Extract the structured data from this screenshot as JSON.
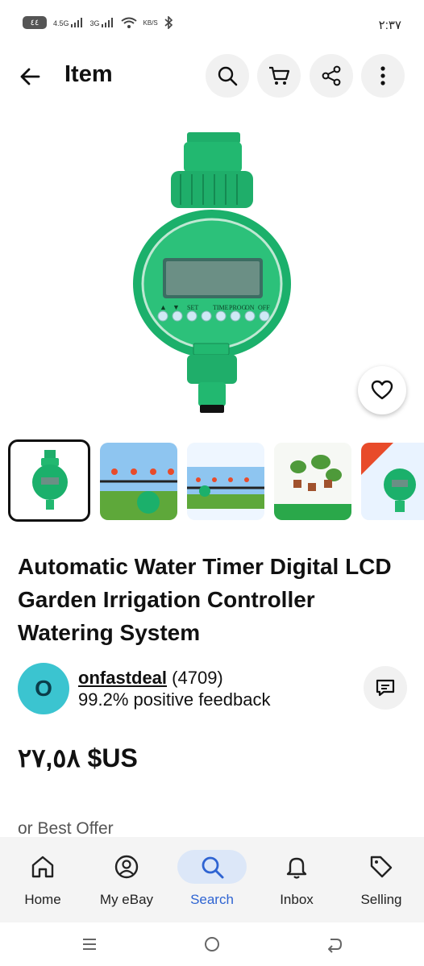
{
  "status_bar": {
    "battery": "٤٤",
    "network1": "4.5G",
    "network2": "3G",
    "speed": "KB/S",
    "time": "٢:٣٧"
  },
  "header": {
    "title": "Item",
    "icons": [
      "back-arrow-icon",
      "search-icon",
      "cart-icon",
      "share-icon",
      "more-vertical-icon"
    ]
  },
  "product": {
    "title": "Automatic Water Timer Digital LCD Garden Irrigation Controller Watering System",
    "hero_labels": [
      "▲",
      "▼",
      "SET",
      "TIME",
      "PROG",
      "ON",
      "OFF"
    ],
    "thumbnail_count": 5
  },
  "seller": {
    "avatar_letter": "O",
    "name": "onfastdeal",
    "count": "(4709)",
    "feedback": "99.2% positive feedback"
  },
  "price": {
    "text": "٢٧,٥٨ $US"
  },
  "offer": {
    "text": "or Best Offer"
  },
  "bottom_nav": {
    "items": [
      {
        "label": "Home",
        "icon": "home-icon"
      },
      {
        "label": "My eBay",
        "icon": "profile-icon"
      },
      {
        "label": "Search",
        "icon": "search-icon"
      },
      {
        "label": "Inbox",
        "icon": "bell-icon"
      },
      {
        "label": "Selling",
        "icon": "tag-icon"
      }
    ],
    "active": "Search"
  },
  "colors": {
    "accent": "#2f64d2",
    "active_bg": "#dce7f8",
    "avatar": "#3bc4d0",
    "product_green": "#1fb36e"
  }
}
